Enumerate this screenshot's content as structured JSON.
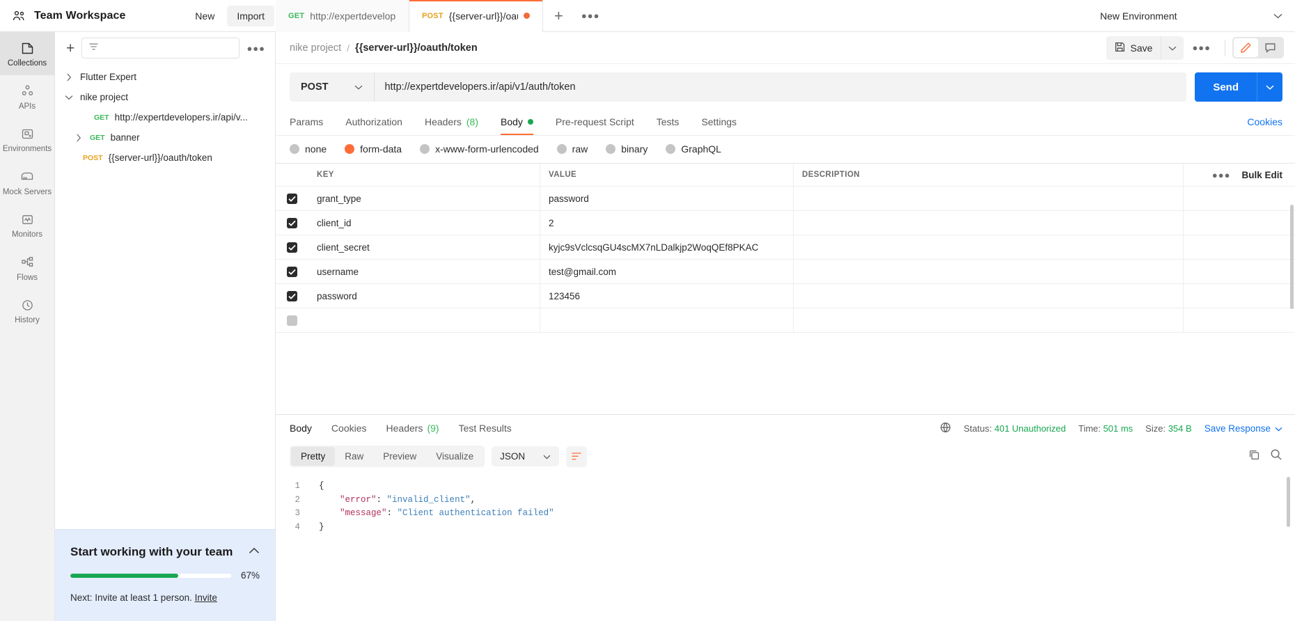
{
  "topbar": {
    "workspace_icon": "team-icon",
    "workspace_title": "Team Workspace",
    "new_label": "New",
    "import_label": "Import",
    "environment_label": "New Environment"
  },
  "request_tabs": [
    {
      "method": "GET",
      "name": "http://expertdevelopers.i",
      "active": false,
      "unsaved": false
    },
    {
      "method": "POST",
      "name": "{{server-url}}/oauth/tc",
      "active": true,
      "unsaved": true
    }
  ],
  "rail": {
    "items": [
      {
        "label": "Collections",
        "icon": "collections-icon",
        "active": true
      },
      {
        "label": "APIs",
        "icon": "apis-icon",
        "active": false
      },
      {
        "label": "Environments",
        "icon": "environments-icon",
        "active": false
      },
      {
        "label": "Mock Servers",
        "icon": "mock-servers-icon",
        "active": false
      },
      {
        "label": "Monitors",
        "icon": "monitors-icon",
        "active": false
      },
      {
        "label": "Flows",
        "icon": "flows-icon",
        "active": false
      },
      {
        "label": "History",
        "icon": "history-icon",
        "active": false
      }
    ]
  },
  "sidebar": {
    "filter_placeholder": "",
    "tree": [
      {
        "label": "Flutter Expert",
        "caret": "right",
        "depth": 0,
        "method": ""
      },
      {
        "label": "nike project",
        "caret": "down",
        "depth": 0,
        "method": ""
      },
      {
        "label": "http://expertdevelopers.ir/api/v...",
        "caret": "",
        "depth": 2,
        "method": "GET"
      },
      {
        "label": "banner",
        "caret": "right",
        "depth": 1,
        "method": "GET"
      },
      {
        "label": "{{server-url}}/oauth/token",
        "caret": "",
        "depth": 2,
        "method": "POST"
      }
    ]
  },
  "team_banner": {
    "title": "Start working with your team",
    "progress_pct": 67,
    "progress_label": "67%",
    "next_text": "Next: Invite at least 1 person.",
    "invite_link": "Invite"
  },
  "breadcrumb": {
    "collection": "nike project",
    "separator": "/",
    "request": "{{server-url}}/oauth/token",
    "save_label": "Save"
  },
  "request": {
    "method": "POST",
    "url": "http://expertdevelopers.ir/api/v1/auth/token",
    "send_label": "Send",
    "tabs": [
      {
        "label": "Params",
        "count": "",
        "active": false,
        "dot": false
      },
      {
        "label": "Authorization",
        "count": "",
        "active": false,
        "dot": false
      },
      {
        "label": "Headers",
        "count": "(8)",
        "active": false,
        "dot": false
      },
      {
        "label": "Body",
        "count": "",
        "active": true,
        "dot": true
      },
      {
        "label": "Pre-request Script",
        "count": "",
        "active": false,
        "dot": false
      },
      {
        "label": "Tests",
        "count": "",
        "active": false,
        "dot": false
      },
      {
        "label": "Settings",
        "count": "",
        "active": false,
        "dot": false
      }
    ],
    "cookies_label": "Cookies",
    "body_modes": [
      {
        "label": "none",
        "selected": false
      },
      {
        "label": "form-data",
        "selected": true
      },
      {
        "label": "x-www-form-urlencoded",
        "selected": false
      },
      {
        "label": "raw",
        "selected": false
      },
      {
        "label": "binary",
        "selected": false
      },
      {
        "label": "GraphQL",
        "selected": false
      }
    ],
    "table": {
      "headers": {
        "key": "KEY",
        "value": "VALUE",
        "description": "DESCRIPTION"
      },
      "bulk_edit_label": "Bulk Edit",
      "rows": [
        {
          "checked": true,
          "key": "grant_type",
          "value": "password",
          "description": ""
        },
        {
          "checked": true,
          "key": "client_id",
          "value": "2",
          "description": ""
        },
        {
          "checked": true,
          "key": "client_secret",
          "value": "kyjc9sVclcsqGU4scMX7nLDalkjp2WoqQEf8PKAC",
          "description": ""
        },
        {
          "checked": true,
          "key": "username",
          "value": "test@gmail.com",
          "description": ""
        },
        {
          "checked": true,
          "key": "password",
          "value": "123456",
          "description": ""
        }
      ]
    }
  },
  "response": {
    "tabs": [
      {
        "label": "Body",
        "count": "",
        "active": true
      },
      {
        "label": "Cookies",
        "count": "",
        "active": false
      },
      {
        "label": "Headers",
        "count": "(9)",
        "active": false
      },
      {
        "label": "Test Results",
        "count": "",
        "active": false
      }
    ],
    "status_label": "Status:",
    "status_value": "401 Unauthorized",
    "time_label": "Time:",
    "time_value": "501 ms",
    "size_label": "Size:",
    "size_value": "354 B",
    "save_response_label": "Save Response",
    "view_modes": [
      {
        "label": "Pretty",
        "active": true
      },
      {
        "label": "Raw",
        "active": false
      },
      {
        "label": "Preview",
        "active": false
      },
      {
        "label": "Visualize",
        "active": false
      }
    ],
    "format": "JSON",
    "body_lines": [
      {
        "n": "1",
        "segments": [
          {
            "t": "{",
            "c": "pun"
          }
        ]
      },
      {
        "n": "2",
        "segments": [
          {
            "t": "    ",
            "c": "pun"
          },
          {
            "t": "\"error\"",
            "c": "key"
          },
          {
            "t": ": ",
            "c": "pun"
          },
          {
            "t": "\"invalid_client\"",
            "c": "str"
          },
          {
            "t": ",",
            "c": "pun"
          }
        ]
      },
      {
        "n": "3",
        "segments": [
          {
            "t": "    ",
            "c": "pun"
          },
          {
            "t": "\"message\"",
            "c": "key"
          },
          {
            "t": ": ",
            "c": "pun"
          },
          {
            "t": "\"Client authentication failed\"",
            "c": "str"
          }
        ]
      },
      {
        "n": "4",
        "segments": [
          {
            "t": "}",
            "c": "pun"
          }
        ]
      }
    ]
  },
  "colors": {
    "accent_orange": "#ff6c37",
    "send_blue": "#1173ef",
    "status_green": "#18a751",
    "method_get": "#3ab95a",
    "method_post": "#e6a11c",
    "banner_bg": "#e4edfc"
  }
}
